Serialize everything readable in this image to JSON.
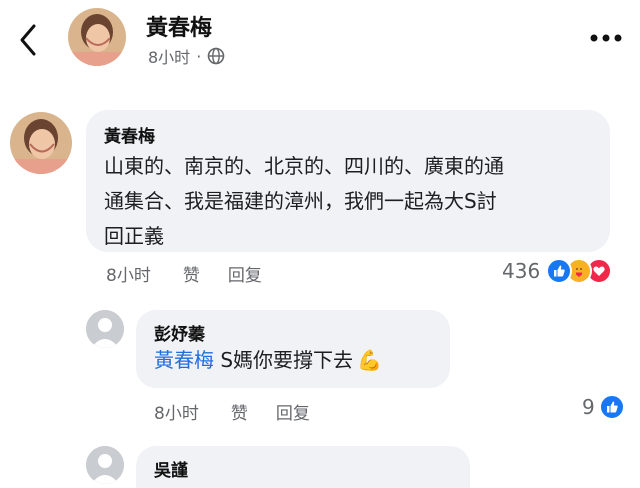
{
  "header": {
    "name": "黃春梅",
    "time": "8小时",
    "separator": "·"
  },
  "comments": [
    {
      "author": "黃春梅",
      "text_line1": "山東的、南京的、北京的、四川的、廣東的通",
      "text_line2": "通集合、我是福建的漳州，我們一起為大S討",
      "text_line3": "回正義",
      "time": "8小时",
      "like": "赞",
      "reply": "回复",
      "reaction_count": "436",
      "reactions": [
        "like-icon",
        "care-icon",
        "love-icon"
      ]
    },
    {
      "author": "彭妤蓁",
      "mention": "黃春梅",
      "text": " S媽你要撐下去",
      "emoji": "💪",
      "time": "8小时",
      "like": "赞",
      "reply": "回复",
      "reaction_count": "9",
      "reactions": [
        "like-icon"
      ]
    },
    {
      "author": "吳謹"
    }
  ],
  "colors": {
    "accent": "#216fdb",
    "like_blue": "#1877f2",
    "love_red": "#f02849",
    "care_yellow": "#f7b125",
    "bubble_bg": "#f0f2f5",
    "meta_gray": "#65676b"
  }
}
